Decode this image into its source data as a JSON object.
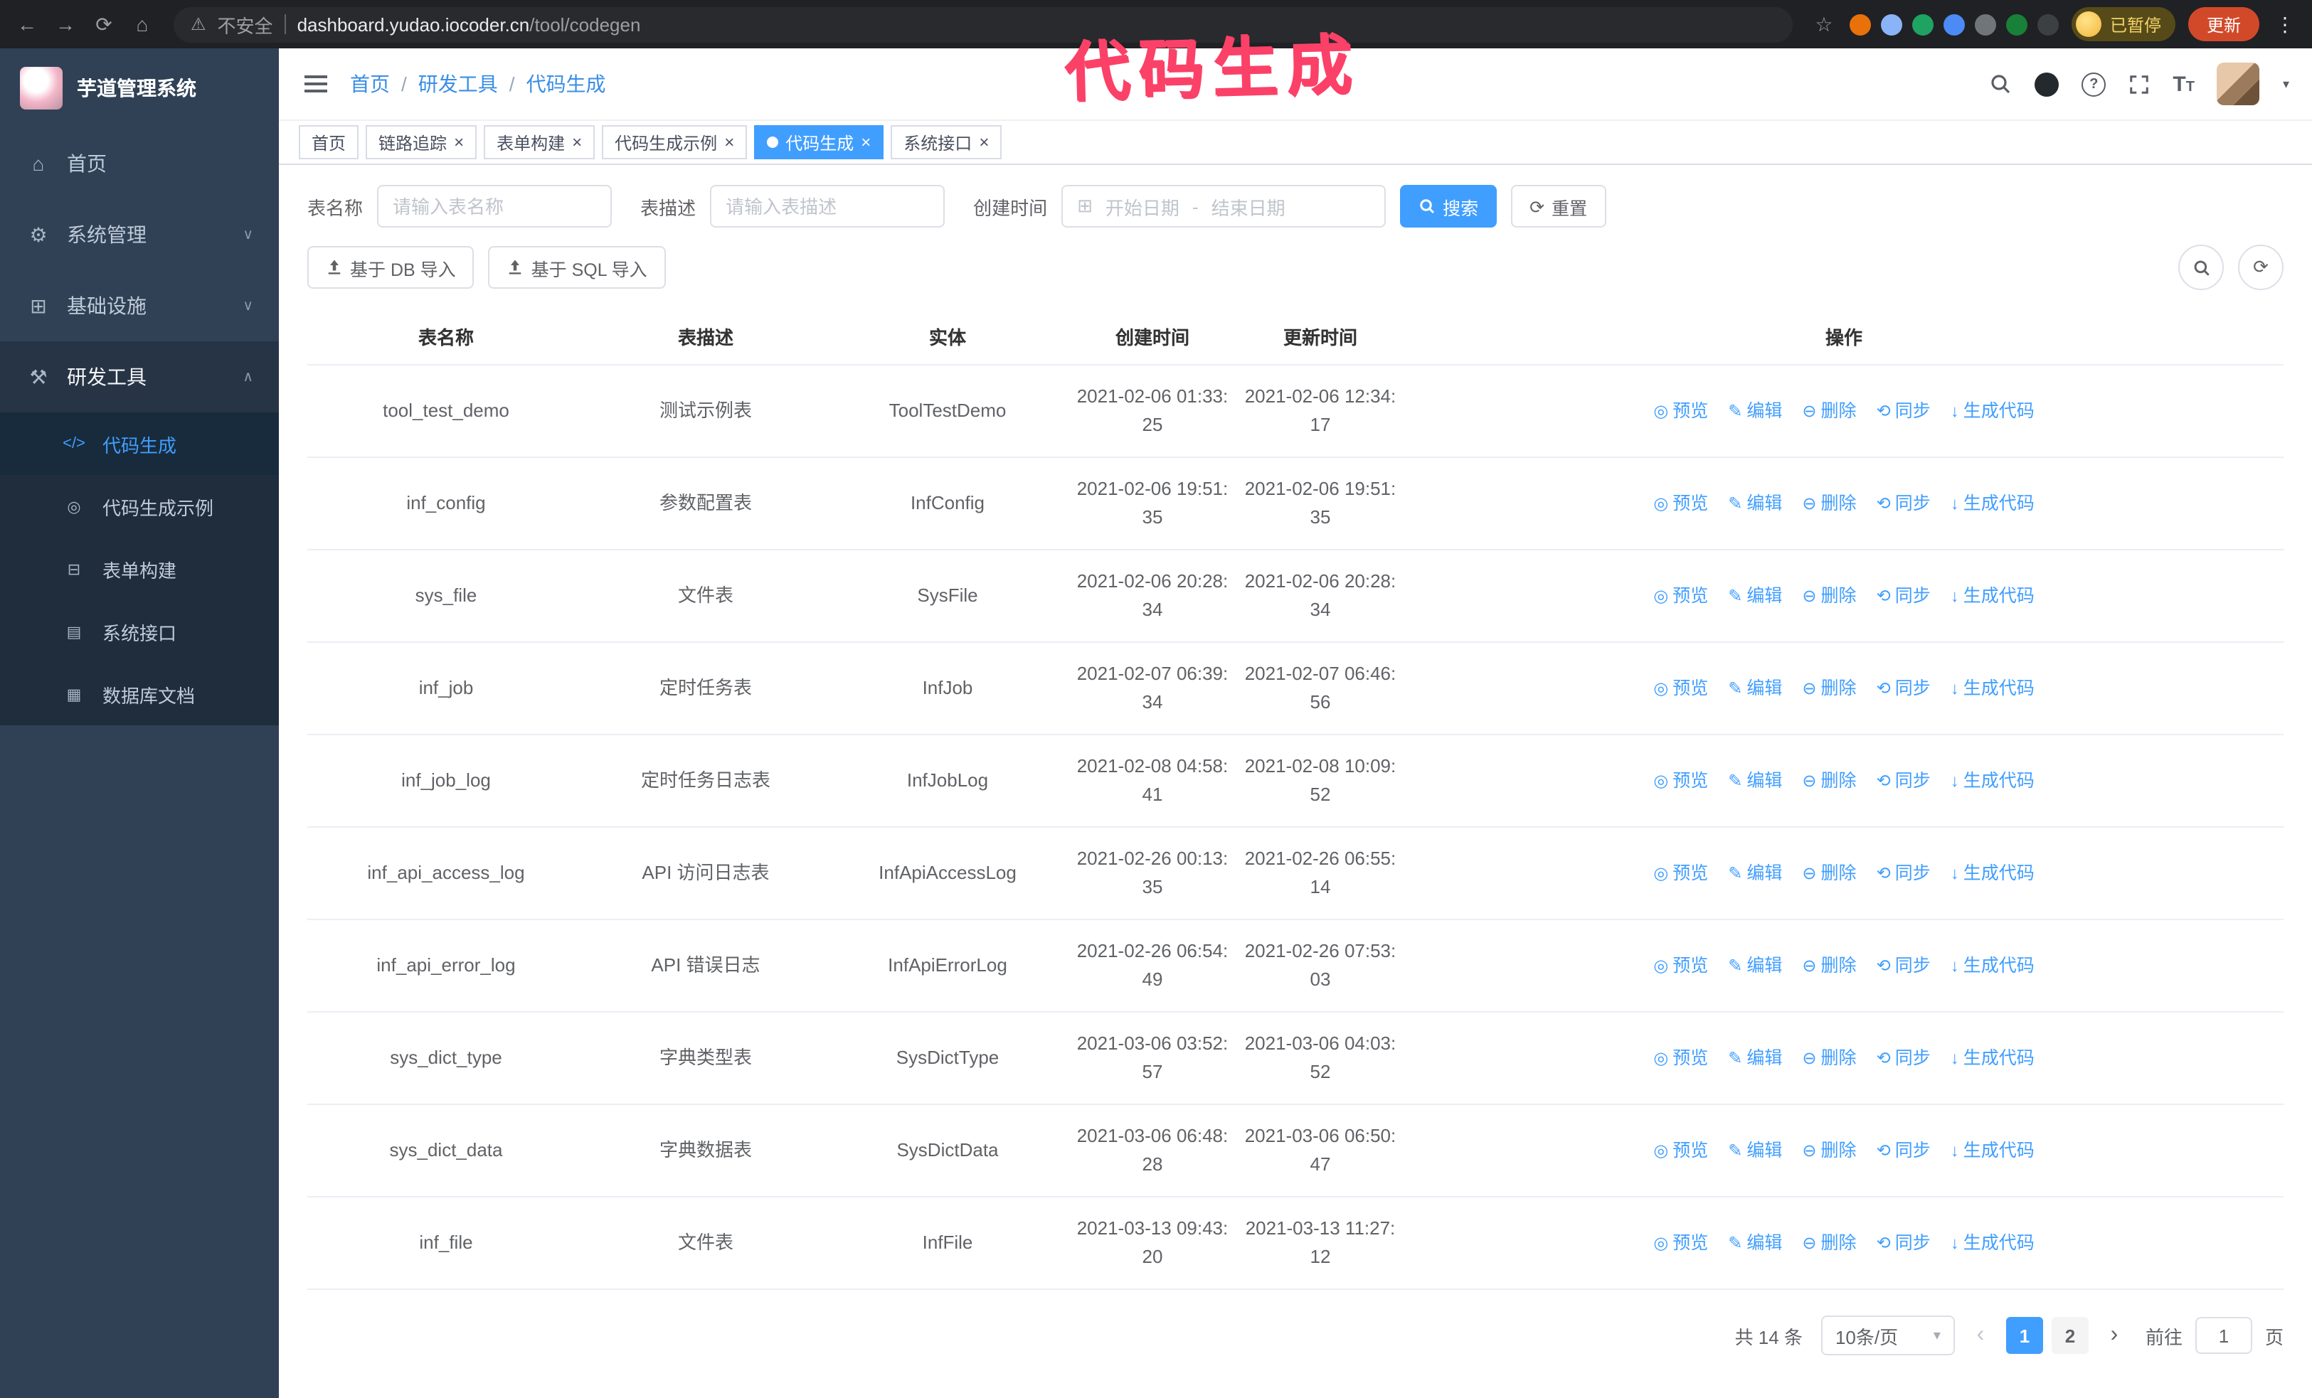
{
  "colors": {
    "accent": "#409eff",
    "sidebar_bg": "#304156",
    "submenu_bg": "#1f2d3d",
    "annotation": "#fb4168"
  },
  "annotation": {
    "text": "代码生成"
  },
  "browser": {
    "security_label": "不安全",
    "url_domain": "dashboard.yudao.iocoder.cn",
    "url_path": "/tool/codegen",
    "profile_label": "已暂停",
    "update_label": "更新",
    "extensions": [
      "#e8710a",
      "#8ab4f8",
      "#1ea362",
      "#4c8bf5",
      "#70757a",
      "#188038",
      "#3c4043"
    ]
  },
  "sidebar": {
    "title": "芋道管理系统",
    "items": [
      {
        "id": "home",
        "label": "首页",
        "icon": "home-icon",
        "glyph": "⌂"
      },
      {
        "id": "system",
        "label": "系统管理",
        "icon": "gear-icon",
        "glyph": "⚙",
        "expandable": true
      },
      {
        "id": "infra",
        "label": "基础设施",
        "icon": "infrastructure-icon",
        "glyph": "⊞",
        "expandable": true
      },
      {
        "id": "devtools",
        "label": "研发工具",
        "icon": "tools-icon",
        "glyph": "⚒",
        "expandable": true,
        "expanded": true,
        "selected": true,
        "children": [
          {
            "id": "codegen",
            "label": "代码生成",
            "icon": "code-icon",
            "glyph": "</>",
            "active": true
          },
          {
            "id": "codegen-example",
            "label": "代码生成示例",
            "icon": "example-icon",
            "glyph": "◎"
          },
          {
            "id": "form-builder",
            "label": "表单构建",
            "icon": "form-icon",
            "glyph": "⊟"
          },
          {
            "id": "api",
            "label": "系统接口",
            "icon": "api-icon",
            "glyph": "▤"
          },
          {
            "id": "db-doc",
            "label": "数据库文档",
            "icon": "database-icon",
            "glyph": "▦"
          }
        ]
      }
    ]
  },
  "header": {
    "breadcrumb": [
      "首页",
      "研发工具",
      "代码生成"
    ]
  },
  "tabs": [
    {
      "id": "home",
      "label": "首页",
      "closable": false
    },
    {
      "id": "tracer",
      "label": "链路追踪",
      "closable": true
    },
    {
      "id": "form-builder",
      "label": "表单构建",
      "closable": true
    },
    {
      "id": "codegen-example",
      "label": "代码生成示例",
      "closable": true
    },
    {
      "id": "codegen",
      "label": "代码生成",
      "closable": true,
      "active": true
    },
    {
      "id": "api",
      "label": "系统接口",
      "closable": true
    }
  ],
  "filters": {
    "name_label": "表名称",
    "name_placeholder": "请输入表名称",
    "desc_label": "表描述",
    "desc_placeholder": "请输入表描述",
    "time_label": "创建时间",
    "start_placeholder": "开始日期",
    "range_separator": "-",
    "end_placeholder": "结束日期",
    "search_label": "搜索",
    "reset_label": "重置"
  },
  "toolbar": {
    "import_db_label": "基于 DB 导入",
    "import_sql_label": "基于 SQL 导入"
  },
  "table": {
    "columns": [
      "表名称",
      "表描述",
      "实体",
      "创建时间",
      "更新时间",
      "操作"
    ],
    "actions": [
      {
        "id": "preview",
        "label": "预览",
        "icon": "eye-icon",
        "glyph": "◎"
      },
      {
        "id": "edit",
        "label": "编辑",
        "icon": "edit-icon",
        "glyph": "✎"
      },
      {
        "id": "delete",
        "label": "删除",
        "icon": "delete-icon",
        "glyph": "⊖"
      },
      {
        "id": "sync",
        "label": "同步",
        "icon": "sync-icon",
        "glyph": "⟲"
      },
      {
        "id": "generate",
        "label": "生成代码",
        "icon": "download-icon",
        "glyph": "↓"
      }
    ],
    "rows": [
      {
        "name": "tool_test_demo",
        "desc": "测试示例表",
        "entity": "ToolTestDemo",
        "created": "2021-02-06 01:33:25",
        "updated": "2021-02-06 12:34:17"
      },
      {
        "name": "inf_config",
        "desc": "参数配置表",
        "entity": "InfConfig",
        "created": "2021-02-06 19:51:35",
        "updated": "2021-02-06 19:51:35"
      },
      {
        "name": "sys_file",
        "desc": "文件表",
        "entity": "SysFile",
        "created": "2021-02-06 20:28:34",
        "updated": "2021-02-06 20:28:34"
      },
      {
        "name": "inf_job",
        "desc": "定时任务表",
        "entity": "InfJob",
        "created": "2021-02-07 06:39:34",
        "updated": "2021-02-07 06:46:56"
      },
      {
        "name": "inf_job_log",
        "desc": "定时任务日志表",
        "entity": "InfJobLog",
        "created": "2021-02-08 04:58:41",
        "updated": "2021-02-08 10:09:52"
      },
      {
        "name": "inf_api_access_log",
        "desc": "API 访问日志表",
        "entity": "InfApiAccessLog",
        "created": "2021-02-26 00:13:35",
        "updated": "2021-02-26 06:55:14"
      },
      {
        "name": "inf_api_error_log",
        "desc": "API 错误日志",
        "entity": "InfApiErrorLog",
        "created": "2021-02-26 06:54:49",
        "updated": "2021-02-26 07:53:03"
      },
      {
        "name": "sys_dict_type",
        "desc": "字典类型表",
        "entity": "SysDictType",
        "created": "2021-03-06 03:52:57",
        "updated": "2021-03-06 04:03:52"
      },
      {
        "name": "sys_dict_data",
        "desc": "字典数据表",
        "entity": "SysDictData",
        "created": "2021-03-06 06:48:28",
        "updated": "2021-03-06 06:50:47"
      },
      {
        "name": "inf_file",
        "desc": "文件表",
        "entity": "InfFile",
        "created": "2021-03-13 09:43:20",
        "updated": "2021-03-13 11:27:12"
      }
    ]
  },
  "pagination": {
    "total_label": "共 14 条",
    "page_size_label": "10条/页",
    "pages": [
      {
        "num": "1",
        "active": true
      },
      {
        "num": "2",
        "active": false
      }
    ],
    "goto_label": "前往",
    "goto_value": "1",
    "page_suffix": "页"
  }
}
